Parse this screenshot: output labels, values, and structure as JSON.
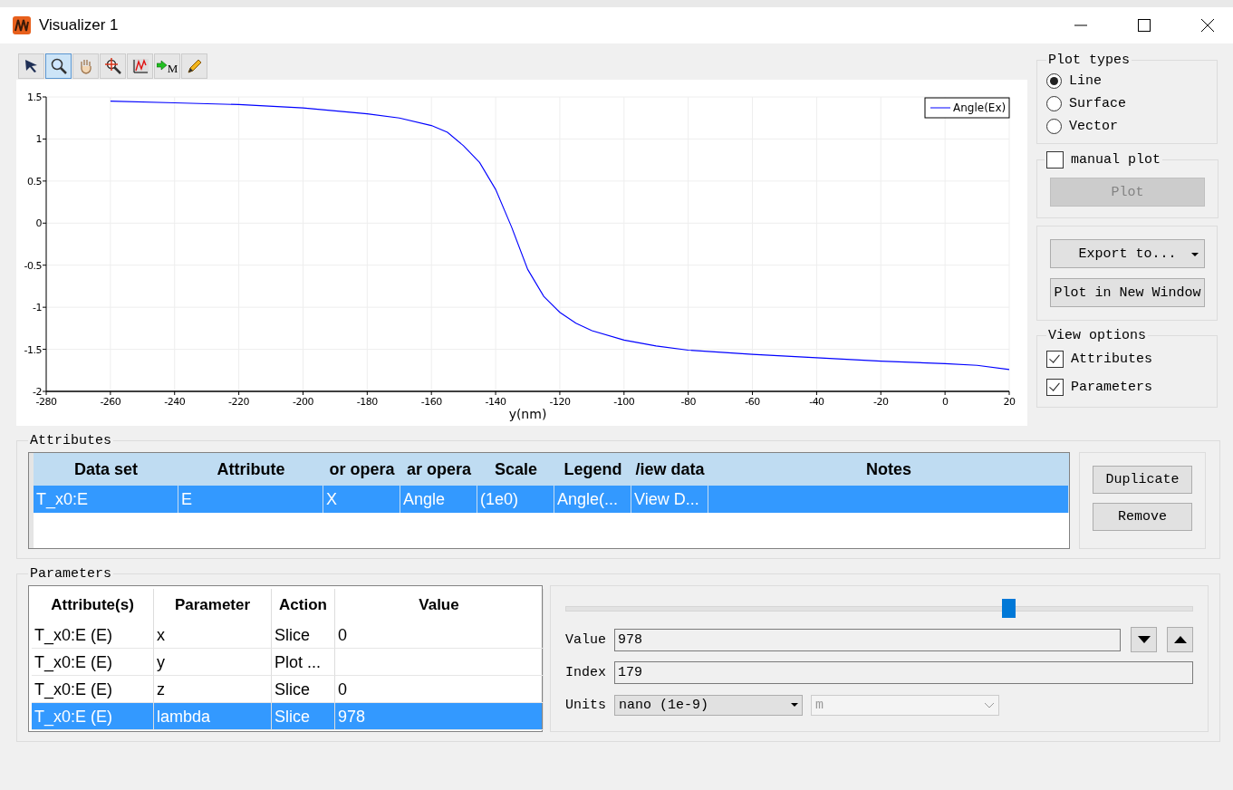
{
  "window": {
    "title": "Visualizer 1"
  },
  "toolbar": [
    {
      "kind": "pointer",
      "selected": false
    },
    {
      "kind": "zoom",
      "selected": true
    },
    {
      "kind": "pan",
      "selected": false
    },
    {
      "kind": "zoom-extent",
      "selected": false
    },
    {
      "kind": "chart",
      "selected": false
    },
    {
      "kind": "marker",
      "selected": false,
      "badge": "M"
    },
    {
      "kind": "pencil",
      "selected": false
    }
  ],
  "chart": {
    "chart_data": {
      "type": "line",
      "grid": true,
      "xlabel": "y(nm)",
      "xlim": [
        -280,
        20
      ],
      "ylim": [
        -2,
        1.5
      ],
      "xticks": [
        -280,
        -260,
        -240,
        -220,
        -200,
        -180,
        -160,
        -140,
        -120,
        -100,
        -80,
        -60,
        -40,
        -20,
        0,
        20
      ],
      "yticks": [
        1.5,
        1,
        0.5,
        0,
        -0.5,
        -1,
        -1.5,
        -2
      ],
      "x": [
        -260,
        -240,
        -220,
        -200,
        -180,
        -170,
        -160,
        -155,
        -150,
        -145,
        -140,
        -135,
        -130,
        -125,
        -120,
        -115,
        -110,
        -100,
        -90,
        -80,
        -60,
        -40,
        -20,
        0,
        10,
        20
      ],
      "series": [
        {
          "name": "Angle(Ex)",
          "color": "#0000ff",
          "values": [
            1.45,
            1.43,
            1.41,
            1.37,
            1.3,
            1.25,
            1.16,
            1.08,
            0.92,
            0.72,
            0.4,
            -0.05,
            -0.55,
            -0.87,
            -1.06,
            -1.19,
            -1.28,
            -1.39,
            -1.46,
            -1.51,
            -1.56,
            -1.6,
            -1.64,
            -1.67,
            -1.69,
            -1.74
          ]
        }
      ]
    }
  },
  "plot_types": {
    "title": "Plot types",
    "options": [
      {
        "label": "Line",
        "selected": true
      },
      {
        "label": "Surface",
        "selected": false
      },
      {
        "label": "Vector",
        "selected": false
      }
    ]
  },
  "manual_plot": {
    "label": "manual plot",
    "checked": false,
    "button": {
      "label": "Plot",
      "disabled": true
    }
  },
  "export": {
    "dropdown": "Export to...",
    "button": "Plot in New Window"
  },
  "view_options": {
    "title": "View options",
    "items": [
      {
        "label": "Attributes",
        "checked": true
      },
      {
        "label": "Parameters",
        "checked": true
      }
    ]
  },
  "attributes": {
    "title": "Attributes",
    "columns": [
      "Data set",
      "Attribute",
      "or opera",
      "ar opera",
      "Scale",
      "Legend",
      "/iew data",
      "Notes"
    ],
    "rows": [
      {
        "cells": [
          "T_x0:E",
          "E",
          "X",
          "Angle",
          "(1e0)",
          "Angle(...",
          "View D...",
          ""
        ],
        "selected": true
      }
    ],
    "buttons": [
      "Duplicate",
      "Remove"
    ]
  },
  "parameters": {
    "title": "Parameters",
    "columns": [
      "Attribute(s)",
      "Parameter",
      "Action",
      "Value"
    ],
    "rows": [
      {
        "cells": [
          "T_x0:E (E)",
          "x",
          "Slice",
          "0"
        ],
        "selected": false
      },
      {
        "cells": [
          "T_x0:E (E)",
          "y",
          "Plot ...",
          ""
        ],
        "selected": false
      },
      {
        "cells": [
          "T_x0:E (E)",
          "z",
          "Slice",
          "0"
        ],
        "selected": false
      },
      {
        "cells": [
          "T_x0:E (E)",
          "lambda",
          "Slice",
          "978"
        ],
        "selected": true
      }
    ],
    "slider": {
      "level": 0.706
    },
    "value": {
      "label": "Value",
      "value": "978"
    },
    "index": {
      "label": "Index",
      "value": "179"
    },
    "units": {
      "label": "Units",
      "value": "nano (1e-9)",
      "unit": "m",
      "unit_disabled": true
    }
  }
}
